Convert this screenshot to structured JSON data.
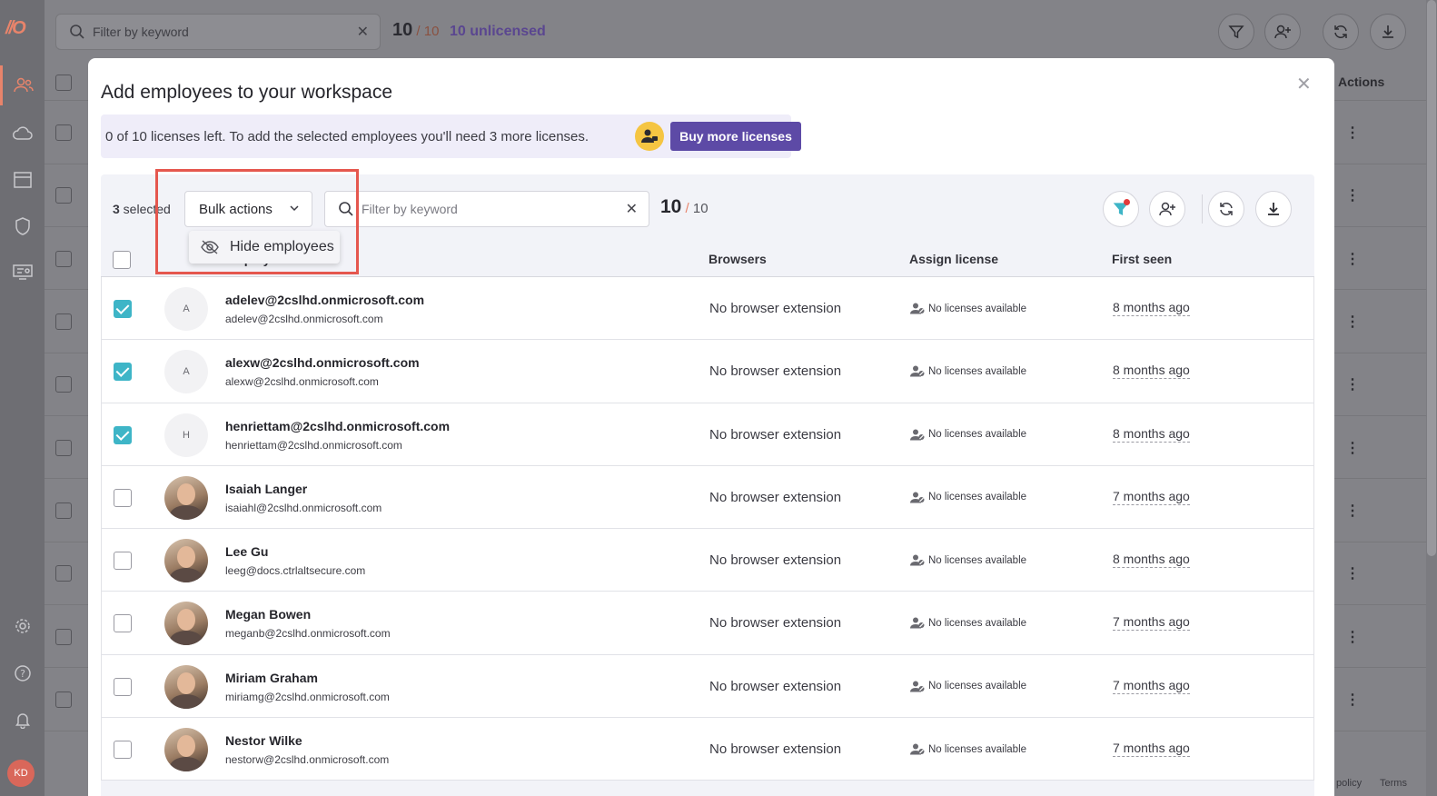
{
  "sidebar": {
    "logo": "//O",
    "items": [
      {
        "icon": "people-icon",
        "active": true
      },
      {
        "icon": "cloud-icon",
        "active": false
      },
      {
        "icon": "browser-window-icon",
        "active": false
      },
      {
        "icon": "shield-icon",
        "active": false
      },
      {
        "icon": "training-icon",
        "active": false
      },
      {
        "icon": "gear-icon",
        "active": false
      },
      {
        "icon": "help-icon",
        "active": false
      },
      {
        "icon": "bell-icon",
        "active": false
      }
    ],
    "avatar_initials": "KD"
  },
  "background": {
    "search_placeholder": "Filter by keyword",
    "count": "10",
    "total": " / 10",
    "unlicensed": "10 unlicensed",
    "actions_header": "Actions",
    "footer_links": [
      "policy",
      "Terms"
    ]
  },
  "modal": {
    "title": "Add employees to your workspace",
    "license_message": "0 of 10 licenses left. To add the selected employees you'll need 3 more licenses.",
    "buy_button": "Buy more licenses",
    "selected_count": "3",
    "selected_label": " selected",
    "bulk_actions_label": "Bulk actions",
    "bulk_menu_item": "Hide employees",
    "search_placeholder": "Filter by keyword",
    "count": "10",
    "total": "10",
    "columns": {
      "employee": "Employee",
      "browsers": "Browsers",
      "assign_license": "Assign license",
      "first_seen": "First seen"
    },
    "rows": [
      {
        "name": "adelev@2cslhd.onmicrosoft.com",
        "email": "adelev@2cslhd.onmicrosoft.com",
        "initial": "A",
        "photo": false,
        "checked": true,
        "browser": "No browser extension",
        "license": "No licenses available",
        "first_seen": "8 months ago"
      },
      {
        "name": "alexw@2cslhd.onmicrosoft.com",
        "email": "alexw@2cslhd.onmicrosoft.com",
        "initial": "A",
        "photo": false,
        "checked": true,
        "browser": "No browser extension",
        "license": "No licenses available",
        "first_seen": "8 months ago"
      },
      {
        "name": "henriettam@2cslhd.onmicrosoft.com",
        "email": "henriettam@2cslhd.onmicrosoft.com",
        "initial": "H",
        "photo": false,
        "checked": true,
        "browser": "No browser extension",
        "license": "No licenses available",
        "first_seen": "8 months ago"
      },
      {
        "name": "Isaiah Langer",
        "email": "isaiahl@2cslhd.onmicrosoft.com",
        "initial": "",
        "photo": true,
        "checked": false,
        "browser": "No browser extension",
        "license": "No licenses available",
        "first_seen": "7 months ago"
      },
      {
        "name": "Lee Gu",
        "email": "leeg@docs.ctrlaltsecure.com",
        "initial": "",
        "photo": true,
        "checked": false,
        "browser": "No browser extension",
        "license": "No licenses available",
        "first_seen": "8 months ago"
      },
      {
        "name": "Megan Bowen",
        "email": "meganb@2cslhd.onmicrosoft.com",
        "initial": "",
        "photo": true,
        "checked": false,
        "browser": "No browser extension",
        "license": "No licenses available",
        "first_seen": "7 months ago"
      },
      {
        "name": "Miriam Graham",
        "email": "miriamg@2cslhd.onmicrosoft.com",
        "initial": "",
        "photo": true,
        "checked": false,
        "browser": "No browser extension",
        "license": "No licenses available",
        "first_seen": "7 months ago"
      },
      {
        "name": "Nestor Wilke",
        "email": "nestorw@2cslhd.onmicrosoft.com",
        "initial": "",
        "photo": true,
        "checked": false,
        "browser": "No browser extension",
        "license": "No licenses available",
        "first_seen": "7 months ago"
      }
    ]
  },
  "colors": {
    "accent": "#5d4aa6",
    "checkbox": "#3eb5c7",
    "highlight": "#e5574e",
    "brand": "#e8846b"
  }
}
